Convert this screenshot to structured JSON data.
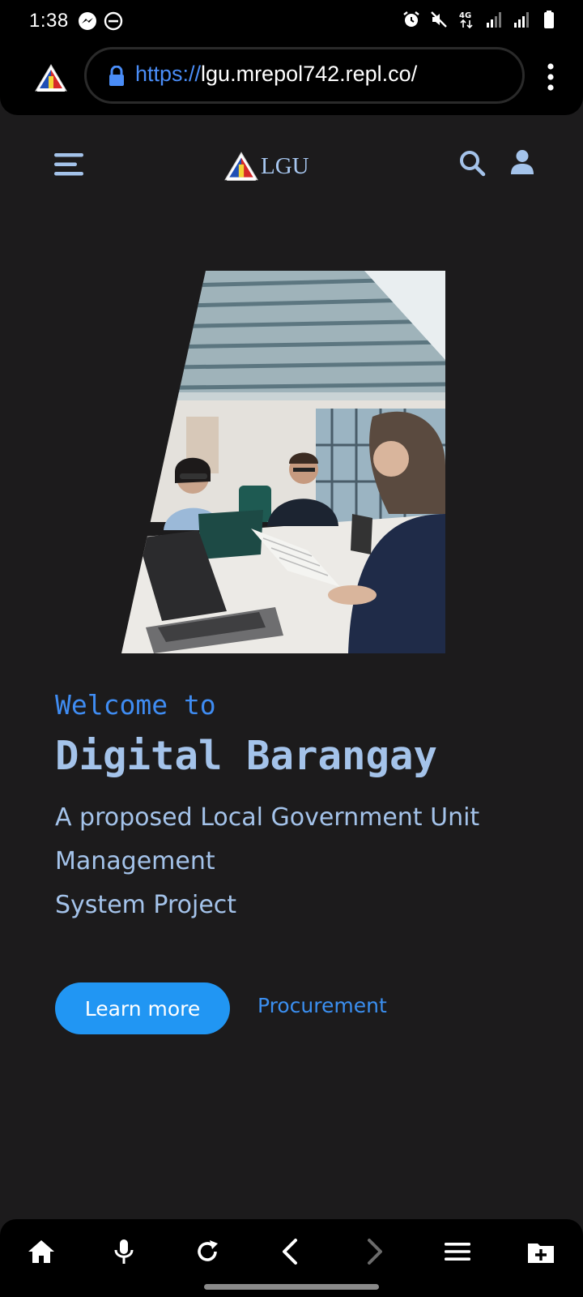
{
  "status_bar": {
    "time": "1:38",
    "left_icons": [
      "messenger-icon",
      "do-not-disturb-icon"
    ],
    "right_icons": [
      "alarm-icon",
      "mute-icon",
      "4g-data-icon",
      "signal-icon",
      "signal-icon",
      "battery-icon"
    ]
  },
  "browser": {
    "url_scheme": "https://",
    "url_rest": "lgu.mrepol742.repl.co/",
    "favicon": "lgu-triangle-logo"
  },
  "site_header": {
    "logo_text": "LGU",
    "icons": [
      "hamburger-menu-icon",
      "search-icon",
      "user-icon"
    ]
  },
  "hero": {
    "welcome": "Welcome to",
    "title": "Digital Barangay",
    "subtitle_lines": [
      "A proposed Local Government Unit",
      "Management",
      "System Project"
    ],
    "primary_button": "Learn more",
    "secondary_link": "Procurement"
  },
  "bottom_toolbar": {
    "icons": [
      "home-icon",
      "microphone-icon",
      "reload-icon",
      "back-icon",
      "forward-icon",
      "tabs-menu-icon",
      "new-tab-icon"
    ]
  },
  "colors": {
    "page_background": "#1c1b1c",
    "accent_blue": "#2196f3",
    "link_blue": "#3b8ff0",
    "text_light_blue": "#a4c3ea"
  }
}
